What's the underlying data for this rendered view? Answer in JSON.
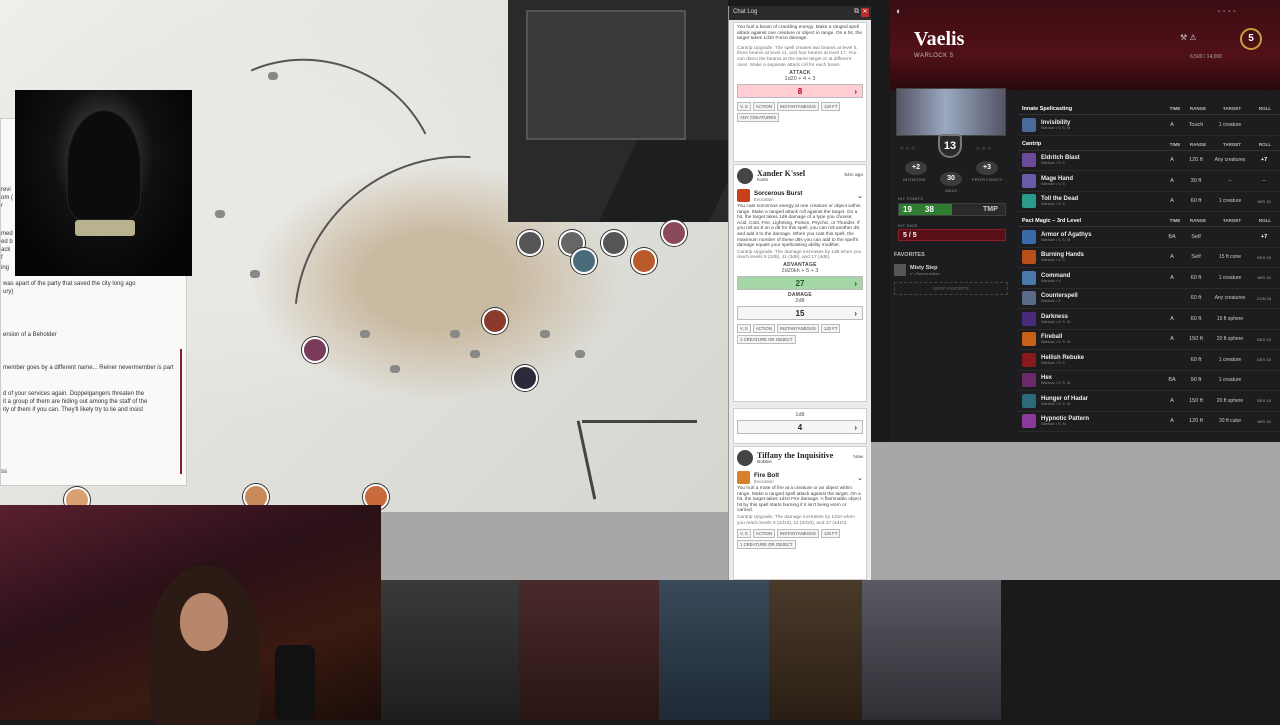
{
  "chat": {
    "title": "Chat Log",
    "first_card": {
      "text": "You hurl a beam of crackling energy. Make a ranged spell attack against one creature or object in range. On a hit, the target takes 1d10 Force damage.",
      "upgrade": "Cantrip Upgrade. The spell creates two beams at level 5, three beams at level 11, and four beams at level 17. You can direct the beams at the same target or at different ones. Make a separate attack roll for each beam.",
      "attack_label": "ATTACK",
      "formula": "1d20 + 4 + 3",
      "result": "8",
      "tags": [
        "V, S",
        "ACTION",
        "INSTANTANEOUS",
        "120 FT",
        "ANY CREATURES"
      ]
    },
    "second_card": {
      "sender": "Xander K'ssel",
      "sender_sub": "Karin",
      "time": "54m ago",
      "spell": "Sorcerous Burst",
      "school": "Evocation",
      "text": "You cast sorcerous energy at one creature or object within range. Make a ranged attack roll against the target. On a hit, the target takes 1d8 damage of a type you choose: Acid, Cold, Fire, Lightning, Poison, Psychic, or Thunder. If you roll an 8 on a d8 for this spell, you can roll another d8, and add it to the damage. When you cast this spell, the maximum number of these d8s you can add to the spell's damage equals your spellcasting ability modifier.",
      "upgrade": "Cantrip Upgrade. The damage increases by 1d8 when you reach levels 5 (2d8), 11 (3d8), and 17 (4d8).",
      "adv_label": "ADVANTAGE",
      "adv_formula": "2d20kh + 5 + 3",
      "adv_result": "27",
      "dmg_label": "DAMAGE",
      "dmg_formula": "2d8",
      "dmg_result": "15",
      "tags": [
        "V, S",
        "ACTION",
        "INSTANTANEOUS",
        "120 FT",
        "1 CREATURE OR OBJECT"
      ]
    },
    "third_card": {
      "formula": "1d8",
      "result": "4"
    },
    "fourth_card": {
      "sender": "Tiffany the Inquisitive",
      "sender_sub": "Bobbie",
      "time": "Now",
      "spell": "Fire Bolt",
      "school": "Evocation",
      "text": "You hurl a mote of fire at a creature or an object within range. Make a ranged spell attack against the target. On a hit, the target takes 1d10 Fire damage. A flammable object hit by this spell starts burning if it isn't being worn or carried.",
      "upgrade": "Cantrip Upgrade. The damage increases by 1d10 when you reach levels 5 (2d10), 11 (3d10), and 17 (4d10).",
      "tags": [
        "V, S",
        "ACTION",
        "INSTANTANEOUS",
        "120 FT",
        "1 CREATURE OR OBJECT"
      ]
    }
  },
  "handout": {
    "lines": [
      "was apart of the party that saved the city long ago",
      "ury)",
      "ersion of a Beholder",
      "member goes by a different name... Reiner nevermember is part",
      "d of your services again. Doppelgangers threaten the",
      "it a group of them are hiding out among the staff of the",
      "ity of them if you can. They'll likely try to lie and insist"
    ],
    "left_frag": [
      "revi",
      "om (",
      "r",
      "med",
      "ed b",
      "ack",
      "f",
      "ing",
      "ss"
    ]
  },
  "sheet": {
    "name": "Vaelis",
    "class": "WARLOCK 5",
    "xp": "6,500 / 14,000",
    "level": "5",
    "ac": "13",
    "initiative": "+2",
    "initiative_label": "INITIATIVE",
    "walk": "30",
    "walk_label": "WALK",
    "proficiency": "+3",
    "proficiency_label": "PROFICIENCY",
    "hp_label": "HIT POINTS",
    "hp_current": "19",
    "hp_max": "38",
    "hp_fraction": 0.5,
    "tmp": "TMP",
    "hd_label": "HIT DICE",
    "hit_dice": "5 / 5",
    "favorites_label": "FAVORITES",
    "favorite": {
      "name": "Misty Step",
      "sub": "V • Bonus Action"
    },
    "drop_label": "DROP FAVORITE",
    "cols": [
      "TIME",
      "RANGE",
      "TARGET",
      "ROLL"
    ],
    "sections": [
      {
        "title": "Innate Spellcasting",
        "spells": [
          {
            "name": "Invisibility",
            "sub": "Warlock • V, S, M",
            "time": "A",
            "range": "Touch",
            "target": "1 creature",
            "roll": "",
            "color": "#4a6a9a"
          }
        ]
      },
      {
        "title": "Cantrip",
        "spells": [
          {
            "name": "Eldritch Blast",
            "sub": "Warlock • V, S",
            "time": "A",
            "range": "120 ft",
            "target": "Any creatures",
            "roll": "+7",
            "color": "#6a4a9a"
          },
          {
            "name": "Mage Hand",
            "sub": "Warlock • V, S",
            "time": "A",
            "range": "30 ft",
            "target": "–",
            "roll": "–",
            "color": "#6a5aaa"
          },
          {
            "name": "Toll the Dead",
            "sub": "Warlock • V, S",
            "time": "A",
            "range": "60 ft",
            "target": "1 creature",
            "roll": "WIS 15",
            "color": "#2a9a8a"
          }
        ]
      },
      {
        "title": "Pact Magic – 3rd Level",
        "spells": [
          {
            "name": "Armor of Agathys",
            "sub": "Warlock • V, S, M",
            "time": "BA",
            "range": "Self",
            "target": "",
            "roll": "+7",
            "color": "#3a6aaa"
          },
          {
            "name": "Burning Hands",
            "sub": "Warlock • V, S",
            "time": "A",
            "range": "Self",
            "target": "15 ft cone",
            "roll": "DEX 15",
            "color": "#b8501a"
          },
          {
            "name": "Command",
            "sub": "Warlock • V",
            "time": "A",
            "range": "60 ft",
            "target": "1 creature",
            "roll": "WIS 15",
            "color": "#4a7aaa"
          },
          {
            "name": "Counterspell",
            "sub": "Warlock • S",
            "time": "",
            "range": "60 ft",
            "target": "Any creatures",
            "roll": "CON 15",
            "color": "#5a6a8a"
          },
          {
            "name": "Darkness",
            "sub": "Warlock • V, S, M",
            "time": "A",
            "range": "60 ft",
            "target": "15 ft sphere",
            "roll": "",
            "color": "#4a2a7a"
          },
          {
            "name": "Fireball",
            "sub": "Warlock • V, S, M",
            "time": "A",
            "range": "150 ft",
            "target": "20 ft sphere",
            "roll": "DEX 15",
            "color": "#c8601a"
          },
          {
            "name": "Hellish Rebuke",
            "sub": "Warlock • V, S",
            "time": "",
            "range": "60 ft",
            "target": "1 creature",
            "roll": "DEX 15",
            "color": "#8a1a1a"
          },
          {
            "name": "Hex",
            "sub": "Warlock • V, S, M",
            "time": "BA",
            "range": "90 ft",
            "target": "1 creature",
            "roll": "",
            "color": "#6a2a6a"
          },
          {
            "name": "Hunger of Hadar",
            "sub": "Warlock • V, S, M",
            "time": "A",
            "range": "150 ft",
            "target": "20 ft sphere",
            "roll": "DEX 15",
            "color": "#2a6a7a"
          },
          {
            "name": "Hypnotic Pattern",
            "sub": "Warlock • S, M",
            "time": "A",
            "range": "120 ft",
            "target": "30 ft cube",
            "roll": "WIS 15",
            "color": "#8a3a9a"
          }
        ]
      }
    ]
  },
  "colors": {
    "accent": "#8b1a2a",
    "success": "#2e7d32",
    "fail": "#ffcdd2",
    "adv": "#a5d6a7"
  }
}
